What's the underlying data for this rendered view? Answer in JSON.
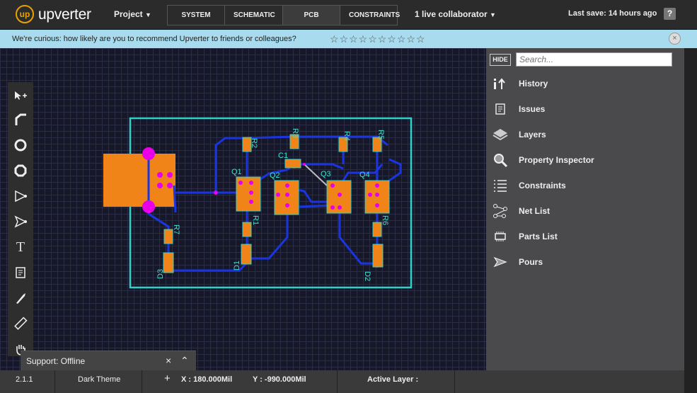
{
  "topbar": {
    "logo_glyph": "up",
    "brand": "upverter",
    "project_menu": "Project",
    "tabs": [
      {
        "label": "SYSTEM",
        "active": false
      },
      {
        "label": "SCHEMATIC",
        "active": false
      },
      {
        "label": "PCB LAYOUT",
        "active": true
      },
      {
        "label": "CONSTRAINTS",
        "active": false
      }
    ],
    "collaborators": "1 live collaborator",
    "last_save": "Last save: 14 hours ago",
    "help": "?"
  },
  "survey": {
    "text": "We're curious: how likely are you to recommend Upverter to friends or colleagues?",
    "stars": "☆☆☆☆☆☆☆☆☆☆",
    "close": "×"
  },
  "toolbar": {
    "tools": [
      "move-tool-icon",
      "trace-tool-icon",
      "via-tool-icon",
      "hole-tool-icon",
      "polygon-tool-icon",
      "pour-tool-icon",
      "text-tool-icon",
      "note-tool-icon",
      "knife-tool-icon",
      "ruler-tool-icon",
      "hand-tool-icon"
    ],
    "text_tool_glyph": "T"
  },
  "pcb": {
    "labels": [
      "R2",
      "R3",
      "R4",
      "R5",
      "C1",
      "Q1",
      "Q2",
      "Q3",
      "Q4",
      "R1",
      "R6",
      "R7",
      "D1",
      "D2",
      "D3"
    ]
  },
  "panel": {
    "hide_label": "HIDE",
    "search_placeholder": "Search...",
    "items": [
      {
        "label": "History",
        "icon": "history-icon"
      },
      {
        "label": "Issues",
        "icon": "issues-icon"
      },
      {
        "label": "Layers",
        "icon": "layers-icon"
      },
      {
        "label": "Property Inspector",
        "icon": "magnifier-icon"
      },
      {
        "label": "Constraints",
        "icon": "constraints-icon"
      },
      {
        "label": "Net List",
        "icon": "netlist-icon"
      },
      {
        "label": "Parts List",
        "icon": "chip-icon"
      },
      {
        "label": "Pours",
        "icon": "pour-icon"
      }
    ]
  },
  "support": {
    "label": "Support: Offline",
    "close": "×",
    "collapse": "⌃"
  },
  "status": {
    "version": "2.1.1",
    "theme": "Dark Theme",
    "x_coord": "X : 180.000Mil",
    "y_coord": "Y : -990.000Mil",
    "active_layer": "Active Layer :"
  },
  "colors": {
    "trace": "#1a35e0",
    "pad": "#e800e8",
    "component": "#f08418",
    "outline": "#2fd0c8",
    "accent": "#e8a200"
  }
}
